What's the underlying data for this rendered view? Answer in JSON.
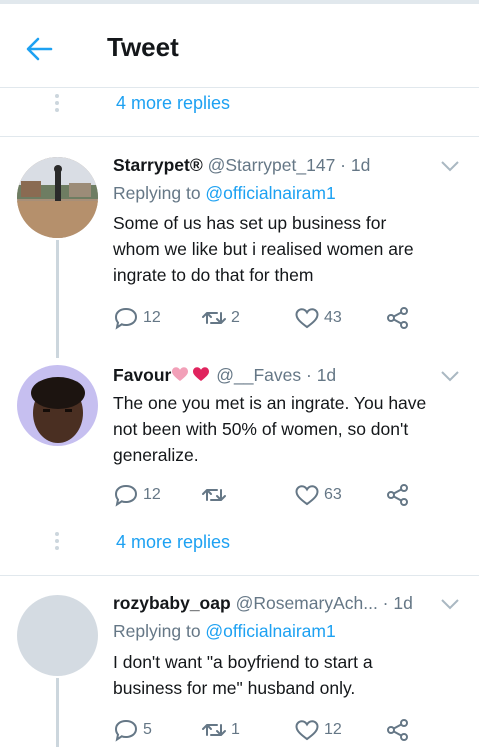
{
  "header": {
    "title": "Tweet"
  },
  "thread": {
    "more_replies_top": "4 more replies",
    "more_replies_mid": "4 more replies"
  },
  "tweets": [
    {
      "name": "Starrypet®",
      "handle": "@Starrypet_147",
      "sep": " · ",
      "time": "1d",
      "replying_prefix": "Replying to ",
      "replying_to": "@officialnairam1",
      "lines": [
        "Some of us has set up business for",
        "whom we like but i realised women are",
        "ingrate to do that for them"
      ],
      "replies": "12",
      "retweets": "2",
      "likes": "43"
    },
    {
      "name": "Favour",
      "handle": "@__Faves",
      "sep": " · ",
      "time": "1d",
      "lines": [
        "The one you met is an ingrate. You have",
        "not been with 50% of women, so don't",
        "generalize."
      ],
      "replies": "12",
      "retweets": "",
      "likes": "63"
    },
    {
      "name": "rozybaby_oap",
      "handle": "@RosemaryAch...",
      "sep": " · ",
      "time": "1d",
      "replying_prefix": "Replying to ",
      "replying_to": "@officialnairam1",
      "lines": [
        "I don't want \"a boyfriend to start a",
        "business for me\" husband only."
      ],
      "replies": "5",
      "retweets": "1",
      "likes": "12"
    }
  ],
  "colors": {
    "accent": "#1da1f2",
    "secondary_text": "#657786",
    "divider": "#e1e8ed",
    "heart_emoji": "#e0245e"
  },
  "icons": [
    "back-arrow-icon",
    "chevron-down-icon",
    "reply-icon",
    "retweet-icon",
    "like-icon",
    "share-icon",
    "heart-emoji-icon"
  ]
}
